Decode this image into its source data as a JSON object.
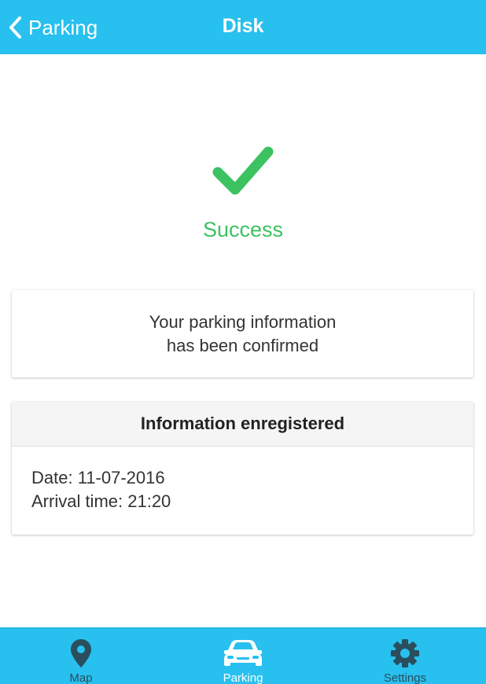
{
  "navbar": {
    "back_label": "Parking",
    "title": "Disk"
  },
  "status": {
    "icon": "checkmark-icon",
    "label": "Success",
    "color": "#3cc261"
  },
  "confirmation": {
    "line1": "Your parking information",
    "line2": "has been confirmed"
  },
  "info_card": {
    "header": "Information enregistered",
    "date_line": "Date: 11-07-2016",
    "arrival_line": "Arrival time: 21:20"
  },
  "tabs": [
    {
      "label": "Map",
      "icon": "map-pin-icon",
      "active": false
    },
    {
      "label": "Parking",
      "icon": "car-icon",
      "active": true
    },
    {
      "label": "Settings",
      "icon": "gear-icon",
      "active": false
    }
  ],
  "colors": {
    "accent": "#27c0ef",
    "success": "#3cc261",
    "inactive_tab": "#2a4e5c"
  }
}
